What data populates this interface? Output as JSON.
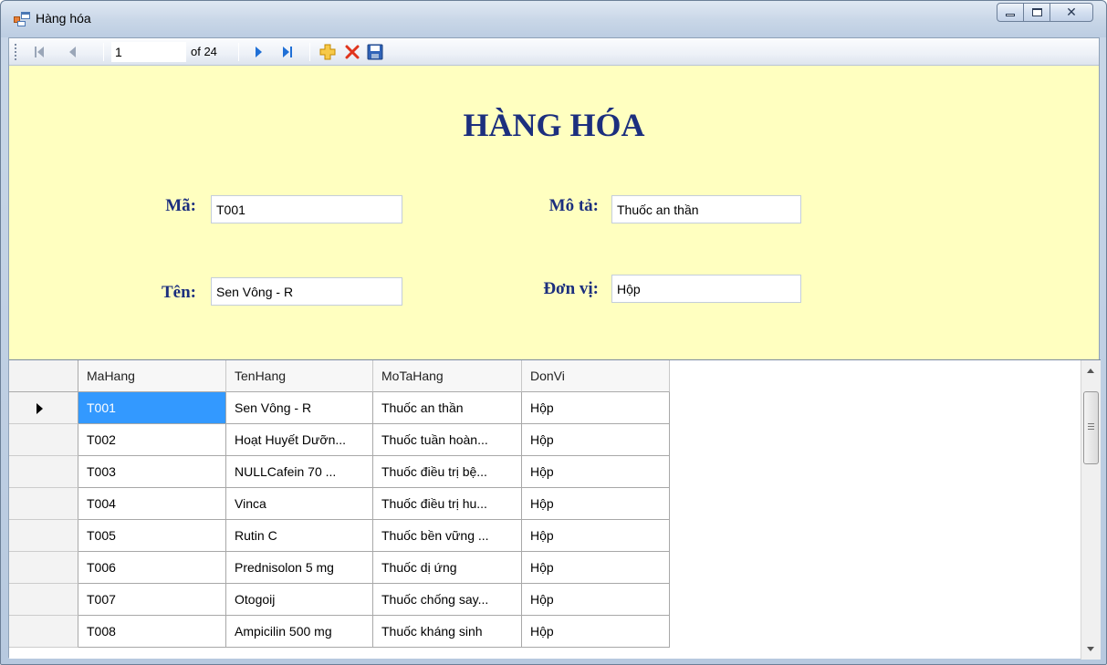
{
  "window": {
    "title": "Hàng hóa",
    "accent_color": "#ffffc0",
    "heading_color": "#1c2f7e",
    "selection_color": "#3399ff"
  },
  "navigator": {
    "position": "1",
    "count_label": "of 24",
    "icons": [
      "move-first-icon",
      "move-previous-icon",
      "move-next-icon",
      "move-last-icon",
      "add-new-icon",
      "delete-icon",
      "save-icon"
    ]
  },
  "form": {
    "heading": "HÀNG HÓA",
    "ma_label": "Mã:",
    "ma_value": "T001",
    "ten_label": "Tên:",
    "ten_value": "Sen Vông - R",
    "mota_label": "Mô tả:",
    "mota_value": "Thuốc an thần",
    "donvi_label": "Đơn vị:",
    "donvi_value": "Hộp"
  },
  "grid": {
    "columns": [
      "MaHang",
      "TenHang",
      "MoTaHang",
      "DonVi"
    ],
    "rows": [
      [
        "T001",
        "Sen Vông - R",
        "Thuốc an thần",
        "Hộp"
      ],
      [
        "T002",
        "Hoạt Huyết Dưỡn...",
        "Thuốc tuần hoàn...",
        "Hộp"
      ],
      [
        "T003",
        "NULLCafein 70 ...",
        "Thuốc điều trị bệ...",
        "Hộp"
      ],
      [
        "T004",
        "Vinca",
        "Thuốc điều trị hu...",
        "Hộp"
      ],
      [
        "T005",
        "Rutin C",
        "Thuốc bền vững ...",
        "Hộp"
      ],
      [
        "T006",
        "Prednisolon 5 mg",
        "Thuốc dị ứng",
        "Hộp"
      ],
      [
        "T007",
        "Otogoij",
        "Thuốc chống say...",
        "Hộp"
      ],
      [
        "T008",
        "Ampicilin 500 mg",
        "Thuốc kháng sinh",
        "Hộp"
      ]
    ]
  }
}
